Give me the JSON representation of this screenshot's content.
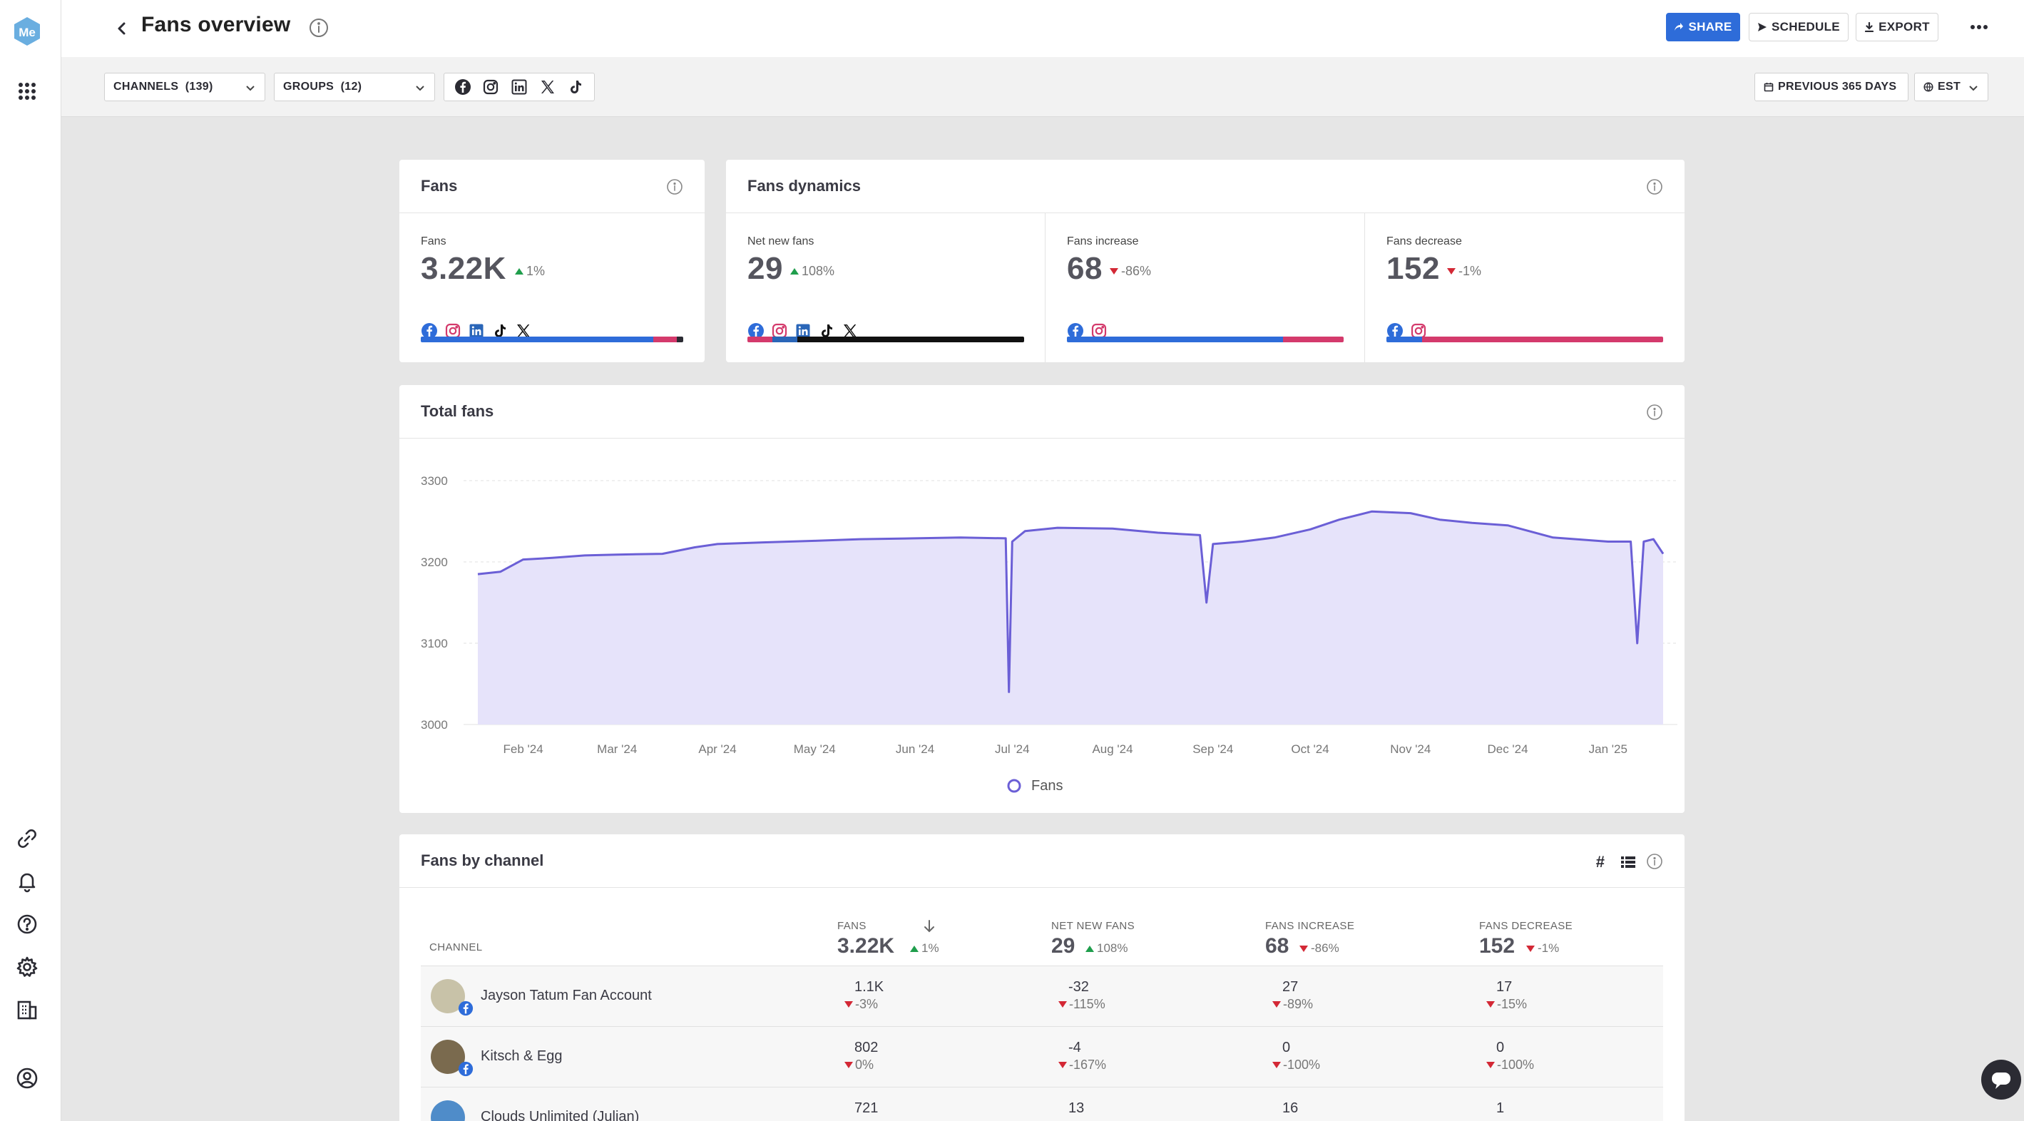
{
  "header": {
    "title": "Fans overview",
    "share_label": "SHARE",
    "schedule_label": "SCHEDULE",
    "export_label": "EXPORT"
  },
  "filters": {
    "channels_label": "CHANNELS  (139)",
    "groups_label": "GROUPS  (12)",
    "date_range_label": "PREVIOUS 365 DAYS",
    "timezone_label": "EST",
    "networks": [
      "facebook-icon",
      "instagram-icon",
      "linkedin-icon",
      "x-icon",
      "tiktok-icon"
    ]
  },
  "fans_card": {
    "title": "Fans",
    "metric_label": "Fans",
    "value": "3.22K",
    "delta": "1%",
    "delta_direction": "up",
    "networks": [
      "facebook-icon",
      "instagram-icon",
      "linkedin-icon",
      "tiktok-icon",
      "x-icon"
    ],
    "share_bar": [
      {
        "network": "facebook",
        "share": 0.885,
        "color": "#2e6cd9"
      },
      {
        "network": "instagram",
        "share": 0.09,
        "color": "#d43a6c"
      },
      {
        "network": "other",
        "share": 0.025,
        "color": "#2b2b33"
      }
    ]
  },
  "dynamics_card": {
    "title": "Fans dynamics",
    "metrics": [
      {
        "label": "Net new fans",
        "value": "29",
        "delta": "108%",
        "delta_direction": "up",
        "networks": [
          "facebook-icon",
          "instagram-icon",
          "linkedin-icon",
          "tiktok-icon",
          "x-icon"
        ],
        "share_bar": [
          {
            "network": "instagram",
            "share": 0.09,
            "color": "#d43a6c"
          },
          {
            "network": "linkedin",
            "share": 0.09,
            "color": "#2a66b8"
          },
          {
            "network": "other",
            "share": 0.82,
            "color": "#111111"
          }
        ]
      },
      {
        "label": "Fans increase",
        "value": "68",
        "delta": "-86%",
        "delta_direction": "down",
        "networks": [
          "facebook-icon",
          "instagram-icon"
        ],
        "share_bar": [
          {
            "network": "facebook",
            "share": 0.78,
            "color": "#2e6cd9"
          },
          {
            "network": "instagram",
            "share": 0.22,
            "color": "#d43a6c"
          }
        ]
      },
      {
        "label": "Fans decrease",
        "value": "152",
        "delta": "-1%",
        "delta_direction": "down",
        "networks": [
          "facebook-icon",
          "instagram-icon"
        ],
        "share_bar": [
          {
            "network": "facebook",
            "share": 0.13,
            "color": "#2e6cd9"
          },
          {
            "network": "instagram",
            "share": 0.87,
            "color": "#d43a6c"
          }
        ]
      }
    ]
  },
  "total_fans_card": {
    "title": "Total fans",
    "legend": "Fans"
  },
  "chart_data": {
    "type": "area",
    "title": "Total fans",
    "x": [
      "2024-01-18",
      "2024-01-25",
      "2024-02-01",
      "2024-02-10",
      "2024-02-20",
      "2024-03-01",
      "2024-03-15",
      "2024-03-25",
      "2024-04-01",
      "2024-04-15",
      "2024-05-01",
      "2024-05-15",
      "2024-06-01",
      "2024-06-15",
      "2024-06-29",
      "2024-06-30",
      "2024-07-01",
      "2024-07-05",
      "2024-07-15",
      "2024-08-01",
      "2024-08-15",
      "2024-08-28",
      "2024-08-30",
      "2024-09-01",
      "2024-09-10",
      "2024-09-20",
      "2024-10-01",
      "2024-10-10",
      "2024-10-20",
      "2024-11-01",
      "2024-11-10",
      "2024-11-20",
      "2024-12-01",
      "2024-12-15",
      "2025-01-01",
      "2025-01-08",
      "2025-01-10",
      "2025-01-12",
      "2025-01-15",
      "2025-01-18"
    ],
    "series": [
      {
        "name": "Fans",
        "color": "#6b5fd6",
        "fill": "#e6e3fa",
        "values": [
          3185,
          3188,
          3203,
          3205,
          3208,
          3209,
          3210,
          3218,
          3222,
          3224,
          3226,
          3228,
          3229,
          3230,
          3229,
          3040,
          3225,
          3238,
          3242,
          3241,
          3236,
          3233,
          3150,
          3222,
          3225,
          3230,
          3240,
          3252,
          3262,
          3260,
          3252,
          3248,
          3245,
          3230,
          3225,
          3225,
          3100,
          3225,
          3228,
          3210
        ]
      }
    ],
    "x_tick_labels": [
      "Feb '24",
      "Mar '24",
      "Apr '24",
      "May '24",
      "Jun '24",
      "Jul '24",
      "Aug '24",
      "Sep '24",
      "Oct '24",
      "Nov '24",
      "Dec '24",
      "Jan '25"
    ],
    "y_ticks": [
      3000,
      3100,
      3200,
      3300
    ],
    "ylim": [
      3000,
      3300
    ],
    "grid": true,
    "legend_position": "bottom-center"
  },
  "channels_table": {
    "title": "Fans by channel",
    "columns": [
      {
        "label": "CHANNEL"
      },
      {
        "label": "FANS",
        "total": "3.22K",
        "delta": "1%",
        "dir": "up"
      },
      {
        "label": "NET NEW FANS",
        "total": "29",
        "delta": "108%",
        "dir": "up"
      },
      {
        "label": "FANS INCREASE",
        "total": "68",
        "delta": "-86%",
        "dir": "down"
      },
      {
        "label": "FANS DECREASE",
        "total": "152",
        "delta": "-1%",
        "dir": "down"
      }
    ],
    "rows": [
      {
        "name": "Jayson Tatum Fan Account",
        "avatar_color": "#c8c2a8",
        "fans": "1.1K",
        "fans_delta": "-3%",
        "net": "-32",
        "net_delta": "-115%",
        "inc": "27",
        "inc_delta": "-89%",
        "dec": "17",
        "dec_delta": "-15%"
      },
      {
        "name": "Kitsch & Egg",
        "avatar_color": "#7a6a4e",
        "fans": "802",
        "fans_delta": "0%",
        "net": "-4",
        "net_delta": "-167%",
        "inc": "0",
        "inc_delta": "-100%",
        "dec": "0",
        "dec_delta": "-100%"
      },
      {
        "name": "Clouds Unlimited (Julian)",
        "avatar_color": "#4f8cc9",
        "fans": "721",
        "fans_delta": "",
        "net": "13",
        "net_delta": "",
        "inc": "16",
        "inc_delta": "",
        "dec": "1",
        "dec_delta": ""
      }
    ]
  }
}
